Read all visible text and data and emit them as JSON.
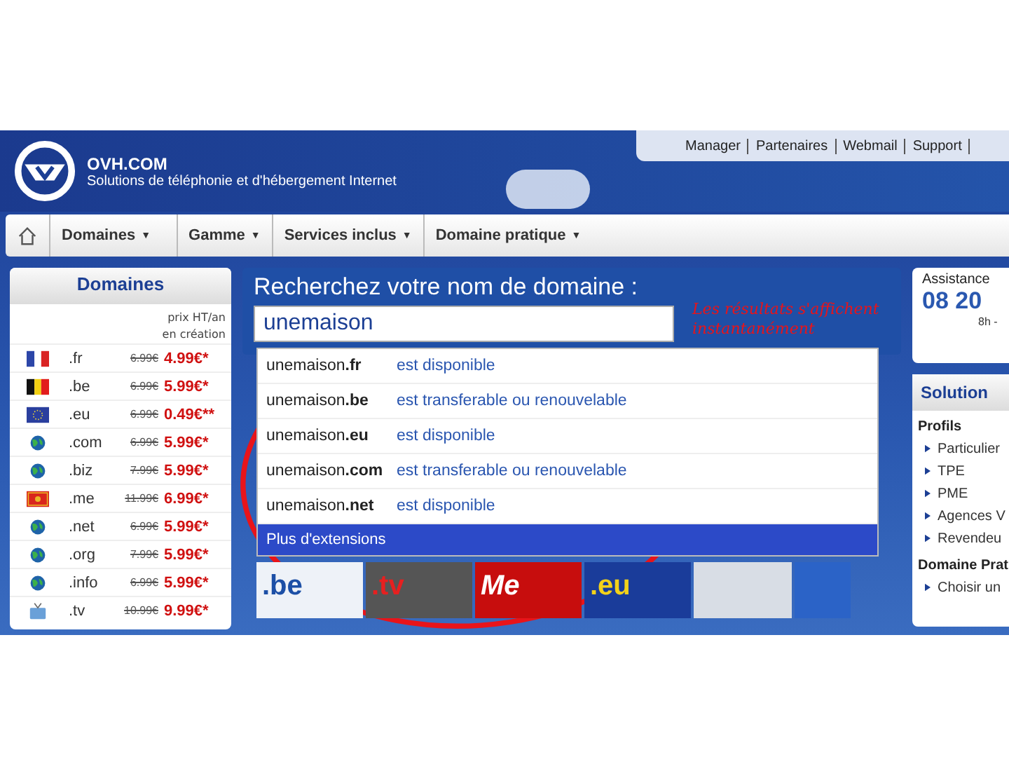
{
  "header": {
    "brand": "OVH.COM",
    "tagline": "Solutions de téléphonie et d'hébergement Internet",
    "links": [
      "Manager",
      "Partenaires",
      "Webmail",
      "Support"
    ]
  },
  "nav": {
    "items": [
      {
        "label": "Domaines",
        "caret": "▼"
      },
      {
        "label": "Gamme",
        "caret": "▼"
      },
      {
        "label": "Services inclus",
        "caret": "▼"
      },
      {
        "label": "Domaine pratique",
        "caret": "▼"
      }
    ]
  },
  "domains": {
    "title": "Domaines",
    "price_note": [
      "prix HT/an",
      "en création"
    ],
    "rows": [
      {
        "kind": "france",
        "ext": ".fr",
        "old_price": "6.99€",
        "price": "4.99€*"
      },
      {
        "kind": "belgium",
        "ext": ".be",
        "old_price": "6.99€",
        "price": "5.99€*"
      },
      {
        "kind": "europe",
        "ext": ".eu",
        "old_price": "6.99€",
        "price": "0.49€**"
      },
      {
        "kind": "globe",
        "ext": ".com",
        "old_price": "6.99€",
        "price": "5.99€*"
      },
      {
        "kind": "globe",
        "ext": ".biz",
        "old_price": "7.99€",
        "price": "5.99€*"
      },
      {
        "kind": "montenegro",
        "ext": ".me",
        "old_price": "11.99€",
        "price": "6.99€*"
      },
      {
        "kind": "globe",
        "ext": ".net",
        "old_price": "6.99€",
        "price": "5.99€*"
      },
      {
        "kind": "globe",
        "ext": ".org",
        "old_price": "7.99€",
        "price": "5.99€*"
      },
      {
        "kind": "globe",
        "ext": ".info",
        "old_price": "6.99€",
        "price": "5.99€*"
      },
      {
        "kind": "tv",
        "ext": ".tv",
        "old_price": "10.99€",
        "price": "9.99€*"
      }
    ]
  },
  "search": {
    "title": "Recherchez votre nom de domaine :",
    "value": "unemaison",
    "suggestions": [
      {
        "domain": "unemaison**.fr**",
        "status": "est disponible"
      },
      {
        "domain": "unemaison**.be**",
        "status": "est transferable ou renouvelable"
      },
      {
        "domain": "unemaison**.eu**",
        "status": "est disponible"
      },
      {
        "domain": "unemaison**.com**",
        "status": "est transferable ou renouvelable"
      },
      {
        "domain": "unemaison**.net**",
        "status": "est disponible"
      }
    ],
    "more": "Plus d'extensions",
    "banners": [
      ".be",
      ".tv",
      "Me",
      ".eu"
    ]
  },
  "annotation": {
    "text": "Les résultats s'affichent instantanément"
  },
  "assistance": {
    "title": "Assistance",
    "phone": "08 20",
    "hours": "8h -"
  },
  "solutions": {
    "title": "Solution",
    "sections": [
      {
        "heading": "Profils",
        "items": [
          "Particulier",
          "TPE",
          "PME",
          "Agences V",
          "Revendeu"
        ]
      },
      {
        "heading": "Domaine Prat",
        "items": [
          "Choisir un"
        ]
      }
    ]
  }
}
